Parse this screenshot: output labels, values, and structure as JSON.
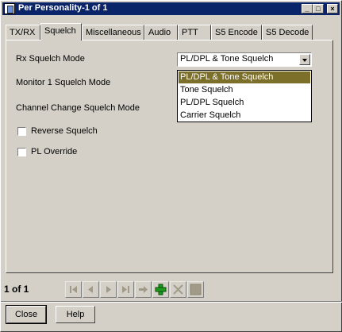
{
  "window": {
    "title": "Per Personality-1 of 1"
  },
  "tabs": [
    {
      "label": "TX/RX"
    },
    {
      "label": "Squelch"
    },
    {
      "label": "Miscellaneous"
    },
    {
      "label": "Audio"
    },
    {
      "label": "PTT"
    },
    {
      "label": "S5 Encode"
    },
    {
      "label": "S5 Decode"
    }
  ],
  "squelch": {
    "rx_mode_label": "Rx Squelch Mode",
    "rx_mode_value": "PL/DPL & Tone Squelch",
    "rx_mode_options": [
      "PL/DPL & Tone Squelch",
      "Tone Squelch",
      "PL/DPL Squelch",
      "Carrier Squelch"
    ],
    "monitor_label": "Monitor 1 Squelch Mode",
    "channel_change_label": "Channel Change Squelch Mode",
    "reverse_label": "Reverse Squelch",
    "pl_override_label": "PL Override"
  },
  "footer": {
    "record_counter": "1 of 1",
    "close_label": "Close",
    "help_label": "Help"
  },
  "colors": {
    "titlebar": "#0a246a",
    "selected_option": "#7b6f2a",
    "add_icon": "#1e9a1e",
    "delete_icon": "#d4d0c8"
  },
  "icons": [
    "first-record-icon",
    "prev-record-icon",
    "next-record-icon",
    "last-record-icon",
    "goto-icon",
    "add-record-icon",
    "delete-record-icon",
    "save-record-icon"
  ]
}
